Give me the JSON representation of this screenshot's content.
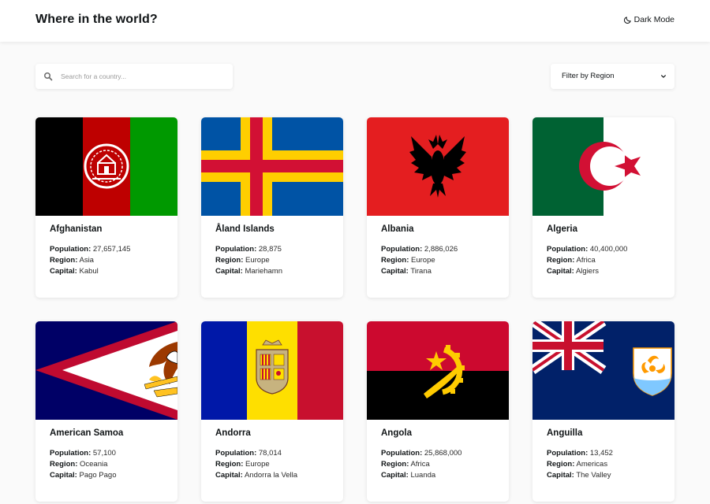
{
  "header": {
    "title": "Where in the world?",
    "mode_label": "Dark Mode"
  },
  "search": {
    "placeholder": "Search for a country...",
    "value": ""
  },
  "filter": {
    "label": "Filter by Region"
  },
  "labels": {
    "population": "Population:",
    "region": "Region:",
    "capital": "Capital:"
  },
  "countries": [
    {
      "name": "Afghanistan",
      "population": "27,657,145",
      "region": "Asia",
      "capital": "Kabul",
      "flag_icon": "afghanistan-flag"
    },
    {
      "name": "Åland Islands",
      "population": "28,875",
      "region": "Europe",
      "capital": "Mariehamn",
      "flag_icon": "aland-islands-flag"
    },
    {
      "name": "Albania",
      "population": "2,886,026",
      "region": "Europe",
      "capital": "Tirana",
      "flag_icon": "albania-flag"
    },
    {
      "name": "Algeria",
      "population": "40,400,000",
      "region": "Africa",
      "capital": "Algiers",
      "flag_icon": "algeria-flag"
    },
    {
      "name": "American Samoa",
      "population": "57,100",
      "region": "Oceania",
      "capital": "Pago Pago",
      "flag_icon": "american-samoa-flag"
    },
    {
      "name": "Andorra",
      "population": "78,014",
      "region": "Europe",
      "capital": "Andorra la Vella",
      "flag_icon": "andorra-flag"
    },
    {
      "name": "Angola",
      "population": "25,868,000",
      "region": "Africa",
      "capital": "Luanda",
      "flag_icon": "angola-flag"
    },
    {
      "name": "Anguilla",
      "population": "13,452",
      "region": "Americas",
      "capital": "The Valley",
      "flag_icon": "anguilla-flag"
    }
  ],
  "colors": {
    "background": "#fafafa",
    "element": "#ffffff",
    "text": "#111517"
  }
}
